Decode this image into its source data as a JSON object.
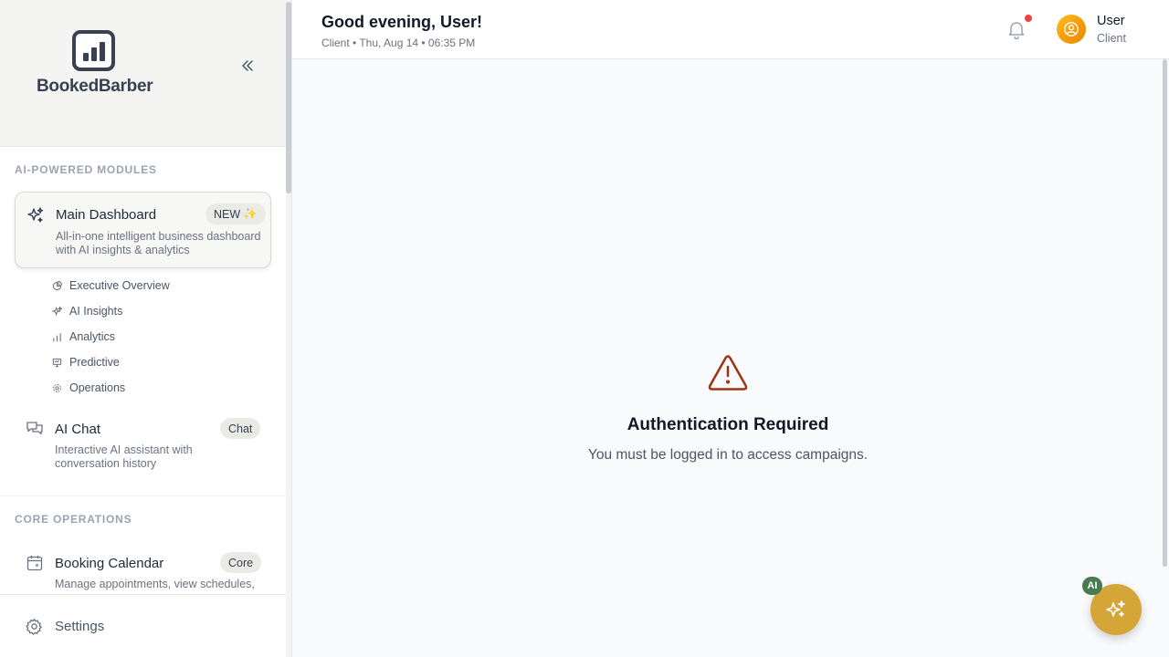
{
  "brand": {
    "name": "BookedBarber"
  },
  "sidebar": {
    "section_ai": "AI-POWERED MODULES",
    "section_core": "CORE OPERATIONS",
    "main_dashboard": {
      "title": "Main Dashboard",
      "badge": "NEW",
      "badge_emoji": "✨",
      "description": "All-in-one intelligent business dashboard with AI insights & analytics"
    },
    "sub_items": [
      {
        "label": "Executive Overview",
        "icon": "pie-chart-icon"
      },
      {
        "label": "AI Insights",
        "icon": "sparkles-icon"
      },
      {
        "label": "Analytics",
        "icon": "bar-chart-icon"
      },
      {
        "label": "Predictive",
        "icon": "presentation-icon"
      },
      {
        "label": "Operations",
        "icon": "gear-icon"
      }
    ],
    "ai_chat": {
      "title": "AI Chat",
      "badge": "Chat",
      "description": "Interactive AI assistant with conversation history"
    },
    "booking_calendar": {
      "title": "Booking Calendar",
      "badge": "Core",
      "description": "Manage appointments, view schedules,"
    },
    "settings_label": "Settings"
  },
  "header": {
    "greeting": "Good evening, User!",
    "subline": "Client • Thu, Aug 14 • 06:35 PM",
    "user_name": "User",
    "user_role": "Client"
  },
  "main": {
    "title": "Authentication Required",
    "message": "You must be logged in to access campaigns."
  },
  "fab": {
    "badge": "AI"
  },
  "colors": {
    "accent_gold": "#d4a537",
    "warning": "#9a3412",
    "notification": "#ef4444",
    "ai_badge": "#4a7a4f"
  }
}
